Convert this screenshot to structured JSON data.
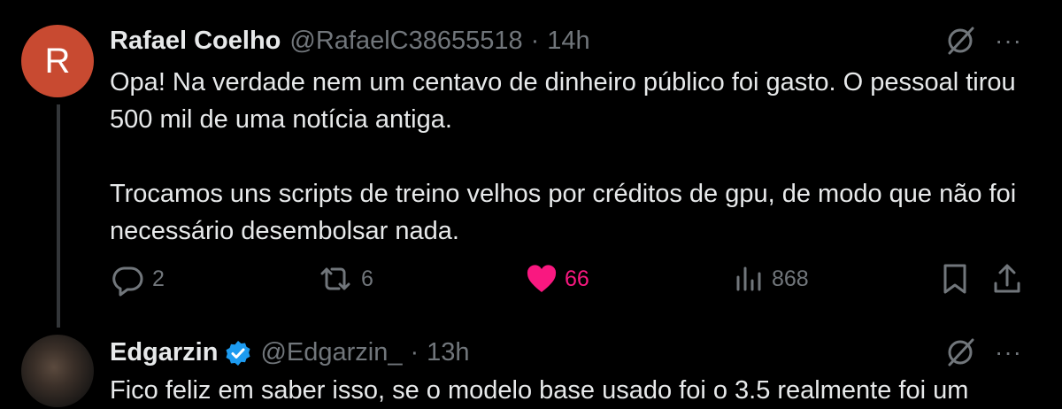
{
  "tweet1": {
    "avatar_letter": "R",
    "avatar_color": "#c84a31",
    "name": "Rafael Coelho",
    "handle": "@RafaelC38655518",
    "separator": "·",
    "time": "14h",
    "paragraphs": [
      "Opa! Na verdade nem um centavo de dinheiro público foi gasto. O pessoal tirou 500 mil de uma notícia antiga.",
      "Trocamos uns scripts de treino velhos por créditos de gpu, de modo que não foi necessário desembolsar nada."
    ],
    "actions": {
      "replies": "2",
      "reposts": "6",
      "likes": "66",
      "views": "868"
    },
    "more_label": "···",
    "icons": [
      "reply-icon",
      "repost-icon",
      "heart-icon",
      "views-icon",
      "bookmark-icon",
      "share-icon",
      "grok-icon"
    ]
  },
  "tweet2": {
    "name": "Edgarzin",
    "handle": "@Edgarzin_",
    "separator": "·",
    "time": "13h",
    "text_partial": "Fico feliz em saber isso, se o modelo base usado foi o 3.5 realmente foi um",
    "more_label": "···"
  },
  "colors": {
    "background": "#000000",
    "text": "#e7e9ea",
    "muted": "#71767b",
    "like": "#f91880",
    "verified": "#1d9bf0"
  }
}
